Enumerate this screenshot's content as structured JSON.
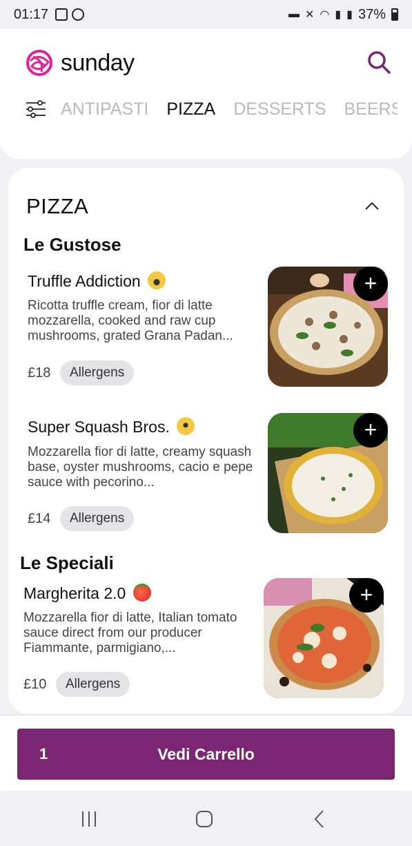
{
  "status_bar": {
    "time": "01:17",
    "battery": "37%"
  },
  "header": {
    "brand": "sunday",
    "tabs": [
      "ANTIPASTI",
      "PIZZA",
      "DESSERTS",
      "BEERS"
    ],
    "active_tab": "PIZZA"
  },
  "menu": {
    "section_title": "PIZZA",
    "groups": [
      {
        "title": "Le Gustose",
        "items": [
          {
            "name": "Truffle Addiction",
            "emoji": "screaming-face-emoji",
            "description": "Ricotta truffle cream, fior di latte mozzarella, cooked and raw cup mushrooms, grated Grana Padan...",
            "price": "£18",
            "allergens_label": "Allergens"
          },
          {
            "name": "Super Squash Bros.",
            "emoji": "disguised-face-emoji",
            "description": "Mozzarella fior di latte, creamy squash base, oyster mushrooms, cacio e pepe sauce with pecorino...",
            "price": "£14",
            "allergens_label": "Allergens"
          }
        ]
      },
      {
        "title": "Le Speciali",
        "items": [
          {
            "name": "Margherita 2.0",
            "emoji": "tomato-emoji",
            "description": "Mozzarella fior di latte, Italian tomato sauce direct from our producer Fiammante, parmigiano,...",
            "price": "£10",
            "allergens_label": "Allergens"
          }
        ]
      }
    ]
  },
  "cart": {
    "count": "1",
    "label": "Vedi Carrello"
  },
  "colors": {
    "accent": "#7b2672",
    "brand_logo": "#e0219a"
  }
}
